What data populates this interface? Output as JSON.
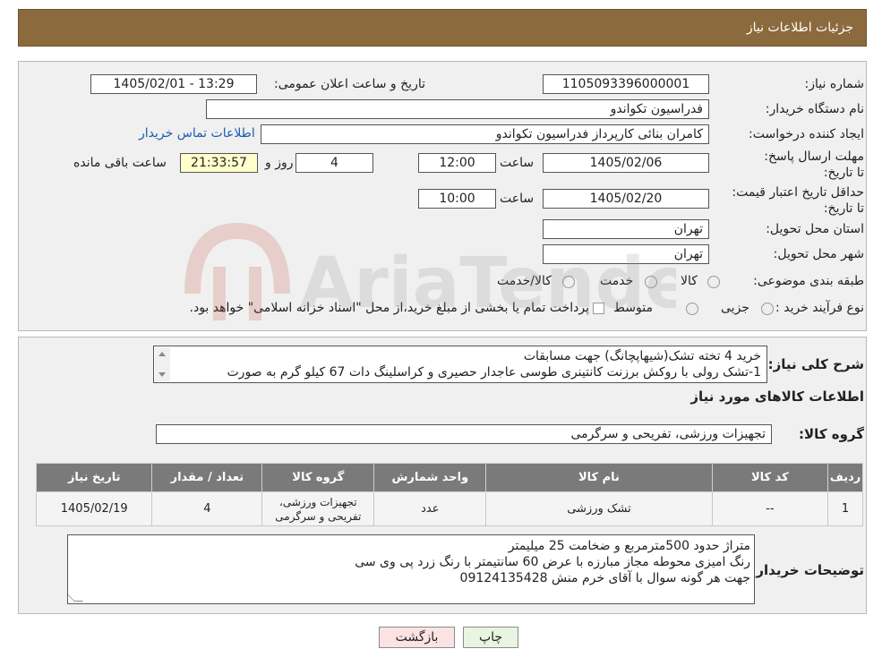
{
  "header": {
    "title": "جزئیات اطلاعات نیاز"
  },
  "fields": {
    "need_number_label": "شماره نیاز:",
    "need_number": "1105093396000001",
    "announce_label": "تاریخ و ساعت اعلان عمومی:",
    "announce_value": "1405/02/01 - 13:29",
    "buyer_org_label": "نام دستگاه خریدار:",
    "buyer_org": "فدراسیون تکواندو",
    "creator_label": "ایجاد کننده درخواست:",
    "creator": "کامران بنائی کارپرداز فدراسیون تکواندو",
    "contact_link": "اطلاعات تماس خریدار",
    "deadline_label": "مهلت ارسال پاسخ: تا تاریخ:",
    "deadline_date": "1405/02/06",
    "time_label": "ساعت",
    "deadline_time": "12:00",
    "days_value": "4",
    "days_label": "روز و",
    "remaining_time": "21:33:57",
    "remaining_label": "ساعت باقی مانده",
    "validity_label": "حداقل تاریخ اعتبار قیمت: تا تاریخ:",
    "validity_date": "1405/02/20",
    "validity_time": "10:00",
    "province_label": "استان محل تحویل:",
    "province": "تهران",
    "city_label": "شهر محل تحویل:",
    "city": "تهران",
    "category_label": "طبقه بندی موضوعی:",
    "category_options": [
      "کالا",
      "خدمت",
      "کالا/خدمت"
    ],
    "process_label": "نوع فرآیند خرید :",
    "process_options": [
      "جزیی",
      "متوسط"
    ],
    "process_note": "پرداخت تمام یا بخشی از مبلغ خرید،از محل \"اسناد خزانه اسلامی\" خواهد بود."
  },
  "description": {
    "label": "شرح کلی نیاز:",
    "lines": [
      "خرید  4 تخته تشک(شیهاپچانگ) جهت مسابقات",
      "1-تشک رولی با روکش برزنت کانتینری طوسی عاجدار حصیری و کراسلینگ دات 67 کیلو گرم به صورت"
    ]
  },
  "goods": {
    "section_title": "اطلاعات کالاهای مورد نیاز",
    "group_label": "گروه کالا:",
    "group_value": "تجهیزات ورزشی، تفریحی و سرگرمی",
    "columns": [
      "ردیف",
      "کد کالا",
      "نام کالا",
      "واحد شمارش",
      "گروه کالا",
      "تعداد / مقدار",
      "تاریخ نیاز"
    ],
    "rows": [
      [
        "1",
        "--",
        "تشک ورزشی",
        "عدد",
        "تجهیزات ورزشی، تفریحی و سرگرمی",
        "4",
        "1405/02/19"
      ]
    ]
  },
  "buyer_notes": {
    "label": "توضیحات خریدار:",
    "lines": [
      "متراژ حدود 500مترمربع و ضخامت 25 میلیمتر",
      "رنگ امیزی محوطه مجاز مبارزه با عرض 60 سانتیمتر با رنگ زرد پی وی سی",
      "جهت هر گونه سوال با آقای خرم منش 09124135428"
    ]
  },
  "buttons": {
    "print": "چاپ",
    "back": "بازگشت"
  },
  "watermark": {
    "text": "AriaTender.neT"
  },
  "colors": {
    "header_bg": "#8b6b3d",
    "link": "#1a5bb5",
    "table_header": "#7a7a7a"
  }
}
